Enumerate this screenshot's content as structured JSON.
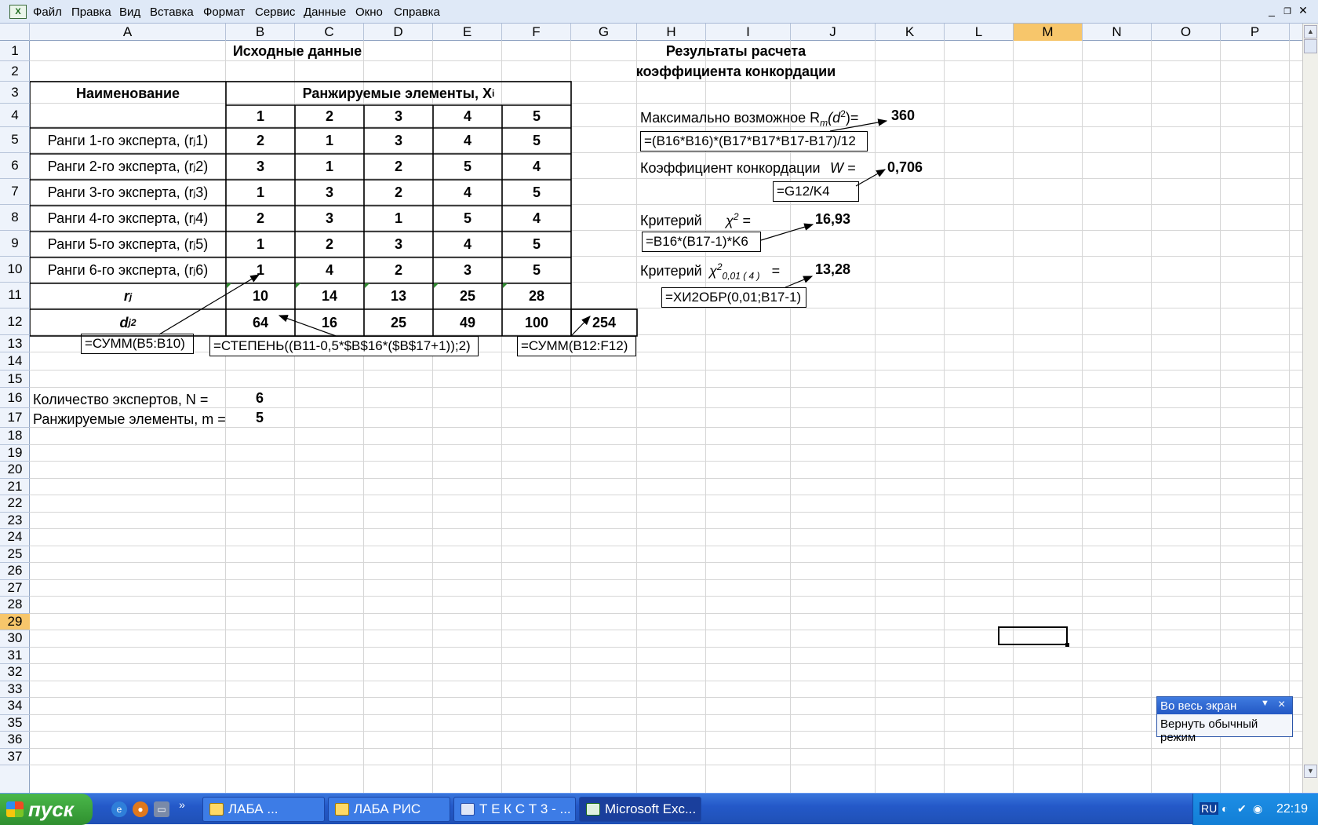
{
  "menu": [
    "Файл",
    "Правка",
    "Вид",
    "Вставка",
    "Формат",
    "Сервис",
    "Данные",
    "Окно",
    "Справка"
  ],
  "columns": [
    "A",
    "B",
    "C",
    "D",
    "E",
    "F",
    "G",
    "H",
    "I",
    "J",
    "K",
    "L",
    "M",
    "N",
    "O",
    "P"
  ],
  "rows": [
    "1",
    "2",
    "3",
    "4",
    "5",
    "6",
    "7",
    "8",
    "9",
    "10",
    "11",
    "12",
    "13",
    "14",
    "15",
    "16",
    "17",
    "18",
    "19",
    "20",
    "21",
    "22",
    "23",
    "24",
    "25",
    "26",
    "27",
    "28",
    "29",
    "30",
    "31",
    "32",
    "33",
    "34",
    "35",
    "36",
    "37"
  ],
  "active_cell": "M29",
  "sheet": {
    "title_source": "Исходные данные",
    "title_results_1": "Результаты расчета",
    "title_results_2": "коэффициента конкордации",
    "header_name": "Наименование",
    "header_ranked": "Ранжируемые элементы, X",
    "header_ranked_sub": "i",
    "element_numbers": [
      "1",
      "2",
      "3",
      "4",
      "5"
    ],
    "experts": [
      {
        "label": "Ранги 1-го эксперта, (r",
        "sub": "j",
        "tail": "1)",
        "ranks": [
          "2",
          "1",
          "3",
          "4",
          "5"
        ]
      },
      {
        "label": "Ранги 2-го эксперта, (r",
        "sub": "j",
        "tail": "2)",
        "ranks": [
          "3",
          "1",
          "2",
          "5",
          "4"
        ]
      },
      {
        "label": "Ранги 3-го эксперта, (r",
        "sub": "j",
        "tail": "3)",
        "ranks": [
          "1",
          "3",
          "2",
          "4",
          "5"
        ]
      },
      {
        "label": "Ранги 4-го эксперта, (r",
        "sub": "j",
        "tail": "4)",
        "ranks": [
          "2",
          "3",
          "1",
          "5",
          "4"
        ]
      },
      {
        "label": "Ранги 5-го эксперта, (r",
        "sub": "j",
        "tail": "5)",
        "ranks": [
          "1",
          "2",
          "3",
          "4",
          "5"
        ]
      },
      {
        "label": "Ранги 6-го эксперта, (r",
        "sub": "j",
        "tail": "6)",
        "ranks": [
          "1",
          "4",
          "2",
          "3",
          "5"
        ]
      }
    ],
    "sum_label": "r",
    "sum_label_sub": "j",
    "sums": [
      "10",
      "14",
      "13",
      "25",
      "28"
    ],
    "dev_label": "d",
    "dev_label_sub": "j",
    "dev_label_sup": "2",
    "devs": [
      "64",
      "16",
      "25",
      "49",
      "100"
    ],
    "dev_total": "254",
    "formula_sum": "=СУММ(B5:B10)",
    "formula_power": "=СТЕПЕНЬ((B11-0,5*$B$16*($B$17+1));2)",
    "formula_total": "=СУММ(B12:F12)",
    "experts_count_label": "Количество экспертов, N =",
    "experts_count": "6",
    "elements_count_label": "Ранжируемые элементы, m =",
    "elements_count": "5",
    "max_label": "Максимально возможное R",
    "max_label_sub": "m",
    "max_label_tail": "(d",
    "max_label_sup": "2",
    "max_label_end": ")=",
    "max_value": "360",
    "max_formula": "=(B16*B16)*(B17*B17*B17-B17)/12",
    "w_label": "Коэффициент конкордации",
    "w_symbol": "W =",
    "w_value": "0,706",
    "w_formula": "=G12/K4",
    "chi_label": "Критерий",
    "chi_symbol": "χ",
    "chi_sup": "2",
    "chi_eq": "=",
    "chi_value": "16,93",
    "chi_formula": "=B16*(B17-1)*K6",
    "chi_crit_label": "Критерий",
    "chi_crit_symbol": "χ",
    "chi_crit_sup": "2",
    "chi_crit_sub": "0,01 ( 4 )",
    "chi_crit_eq": "=",
    "chi_crit_value": "13,28",
    "chi_crit_formula": "=ХИ2ОБР(0,01;B17-1)"
  },
  "fullscreen": {
    "title": "Во весь экран",
    "close": "×",
    "button": "Вернуть обычный режим"
  },
  "taskbar": {
    "start": "пуск",
    "buttons": [
      "ЛАБА          ...",
      "ЛАБА РИС",
      "Т Е К С Т 3 - ...",
      "Microsoft Exc..."
    ],
    "lang": "RU",
    "clock": "22:19"
  }
}
